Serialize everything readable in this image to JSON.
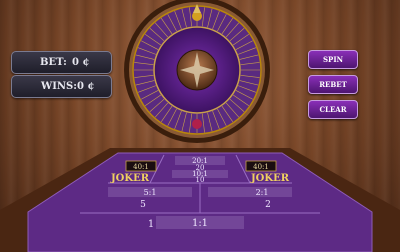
{
  "bet": {
    "label": "BET:",
    "value": "0 ¢"
  },
  "wins": {
    "label": "WINS:",
    "value": "0 ¢"
  },
  "buttons": {
    "spin": "SPIN",
    "rebet": "REBET",
    "clear": "CLEAR"
  },
  "table": {
    "left_joker": "JOKER",
    "right_joker": "JOKER",
    "left_odds": "40:1",
    "right_odds": "40:1",
    "center_top_odds": "20:1",
    "center_top_num": "20",
    "center_mid_odds": "10:1",
    "center_mid_num": "10",
    "left_mid_odds": "5:1",
    "left_mid_num": "5",
    "right_mid_odds": "2:1",
    "right_mid_num": "2",
    "bottom_odds": "1:1",
    "bottom_num": "1"
  },
  "colors": {
    "felt": "#5d2a85",
    "rail": "#5a3015",
    "button": "#6a1f95"
  }
}
